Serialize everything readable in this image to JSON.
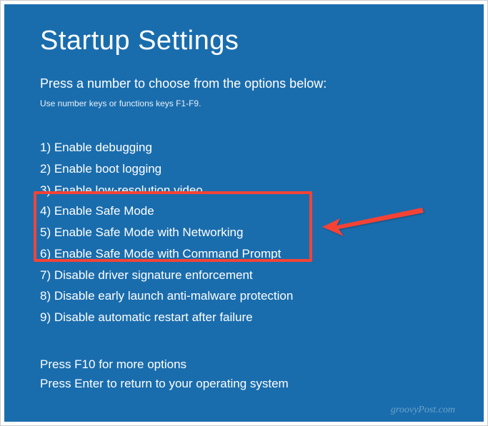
{
  "title": "Startup Settings",
  "subtitle": "Press a number to choose from the options below:",
  "hint": "Use number keys or functions keys F1-F9.",
  "options": [
    "1) Enable debugging",
    "2) Enable boot logging",
    "3) Enable low-resolution video",
    "4) Enable Safe Mode",
    "5) Enable Safe Mode with Networking",
    "6) Enable Safe Mode with Command Prompt",
    "7) Disable driver signature enforcement",
    "8) Disable early launch anti-malware protection",
    "9) Disable automatic restart after failure"
  ],
  "footer": {
    "line1": "Press F10 for more options",
    "line2": "Press Enter to return to your operating system"
  },
  "watermark": "groovyPost.com"
}
